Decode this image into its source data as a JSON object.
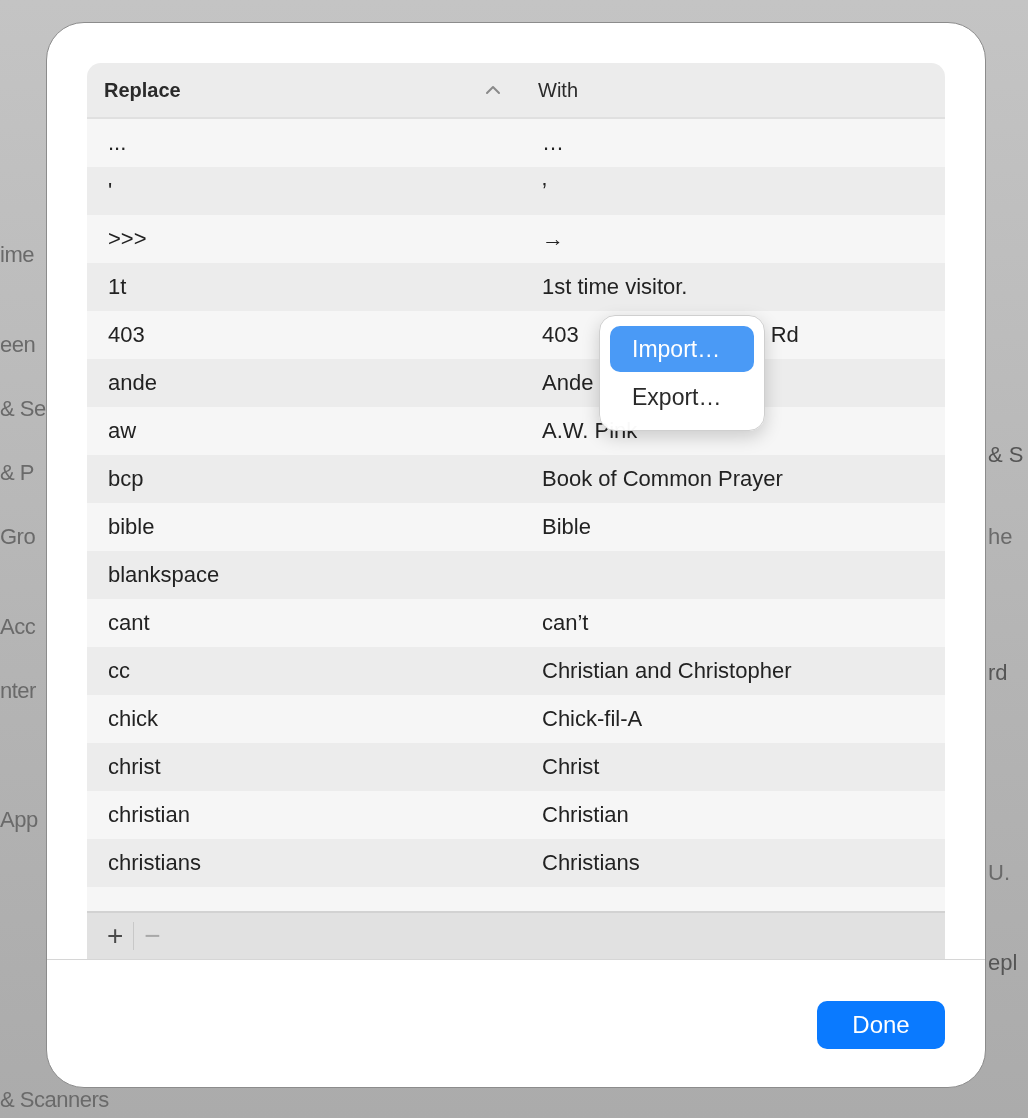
{
  "background": {
    "left_items": [
      "ime",
      "een",
      "& Se",
      "& P",
      "Gro",
      "Acc",
      "nter",
      "App",
      "& Scanners"
    ],
    "right_items": [
      {
        "label": "& S",
        "secondary": false
      },
      {
        "label": "he",
        "secondary": true
      },
      {
        "label": "rd",
        "secondary": false
      },
      {
        "label": "U.",
        "secondary": true
      },
      {
        "label": "epl",
        "secondary": false
      }
    ]
  },
  "sheet": {
    "table": {
      "columns": [
        {
          "label": "Replace",
          "sorted": true
        },
        {
          "label": "With",
          "sorted": false
        }
      ],
      "rows": [
        {
          "replace": "...",
          "with": "…"
        },
        {
          "replace": "'",
          "with": "’"
        },
        {
          "replace": ">>>",
          "with": "→"
        },
        {
          "replace": "1t",
          "with": "1st time visitor."
        },
        {
          "replace": "403",
          "with": "403",
          "with_end": "Rd"
        },
        {
          "replace": "ande",
          "with": "Ande"
        },
        {
          "replace": "aw",
          "with": "A.W. Pink"
        },
        {
          "replace": "bcp",
          "with": "Book of Common Prayer"
        },
        {
          "replace": "bible",
          "with": "Bible"
        },
        {
          "replace": "blankspace"
        },
        {
          "replace": "cant",
          "with": "can’t"
        },
        {
          "replace": "cc",
          "with": "Christian and Christopher"
        },
        {
          "replace": "chick",
          "with": "Chick-fil-A"
        },
        {
          "replace": "christ",
          "with": "Christ"
        },
        {
          "replace": "christian",
          "with": "Christian"
        },
        {
          "replace": "christians",
          "with": "Christians"
        }
      ]
    },
    "footer_buttons": [
      {
        "label": "+",
        "disabled": false
      },
      {
        "label": "−",
        "disabled": true
      }
    ],
    "done_button": "Done"
  },
  "context_menu": {
    "items": [
      {
        "label": "Import…",
        "selected": true
      },
      {
        "label": "Export…",
        "selected": false
      }
    ]
  }
}
